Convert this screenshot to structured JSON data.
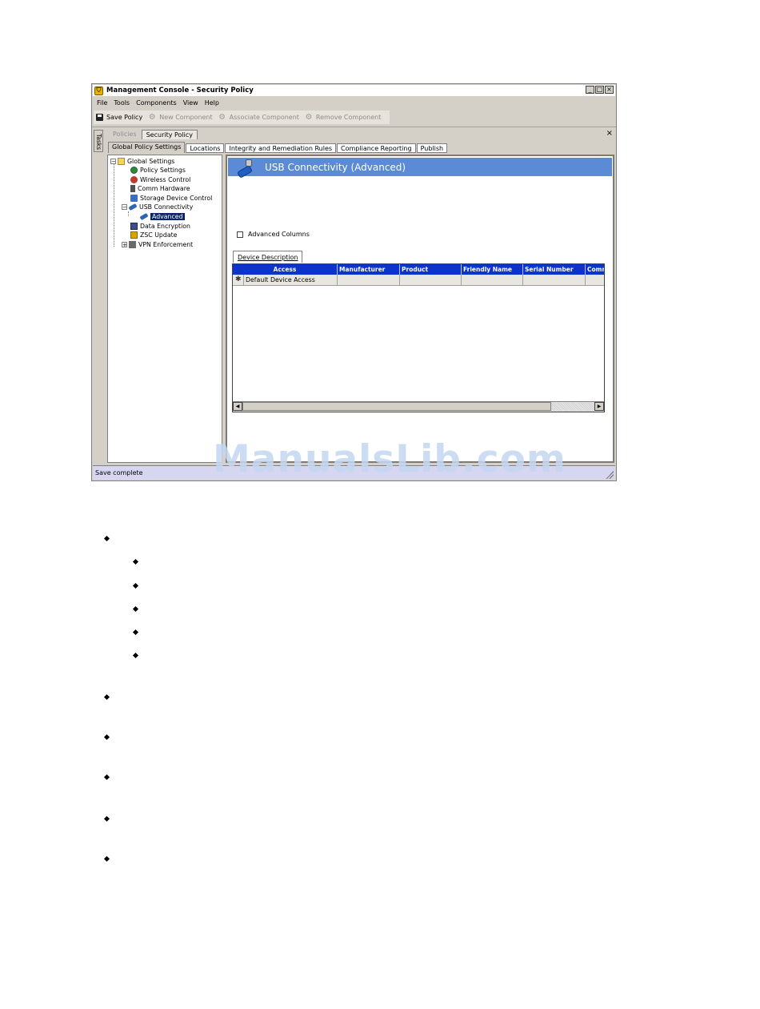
{
  "window": {
    "title": "Management Console - Security Policy",
    "app_icon": "shield-icon",
    "controls": [
      "_",
      "□",
      "×"
    ]
  },
  "menu": [
    "File",
    "Tools",
    "Components",
    "View",
    "Help"
  ],
  "toolbar": {
    "save_policy": "Save Policy",
    "new_component": "New Component",
    "associate_component": "Associate Component",
    "remove_component": "Remove Component"
  },
  "tasks_label": "Tasks",
  "doc_tabs": {
    "policies": "Policies",
    "security_policy": "Security Policy",
    "close": "×"
  },
  "page_tabs": [
    "Global Policy Settings",
    "Locations",
    "Integrity and Remediation Rules",
    "Compliance Reporting",
    "Publish"
  ],
  "tree": {
    "root": "Global Settings",
    "items": [
      "Policy Settings",
      "Wireless Control",
      "Comm Hardware",
      "Storage Device Control",
      "USB Connectivity",
      "Advanced",
      "Data Encryption",
      "ZSC Update",
      "VPN Enforcement"
    ],
    "selected": "Advanced",
    "expand_minus": "−",
    "expand_plus": "+"
  },
  "content": {
    "banner_title": "USB Connectivity (Advanced)",
    "advanced_columns_label": "Advanced Columns",
    "subtab_label": "Device Description",
    "grid": {
      "columns": [
        "Access",
        "Manufacturer",
        "Product",
        "Friendly Name",
        "Serial Number",
        "Comm"
      ],
      "rows": [
        {
          "marker": "✱",
          "access": "Default Device Access"
        }
      ]
    }
  },
  "status": {
    "text": "Save complete"
  },
  "watermark": "ManualsLib.com",
  "colors": {
    "banner": "#5b8ad6",
    "grid_header": "#0a34cc",
    "selection": "#0a246a",
    "statusbar": "#d6d6f0"
  }
}
